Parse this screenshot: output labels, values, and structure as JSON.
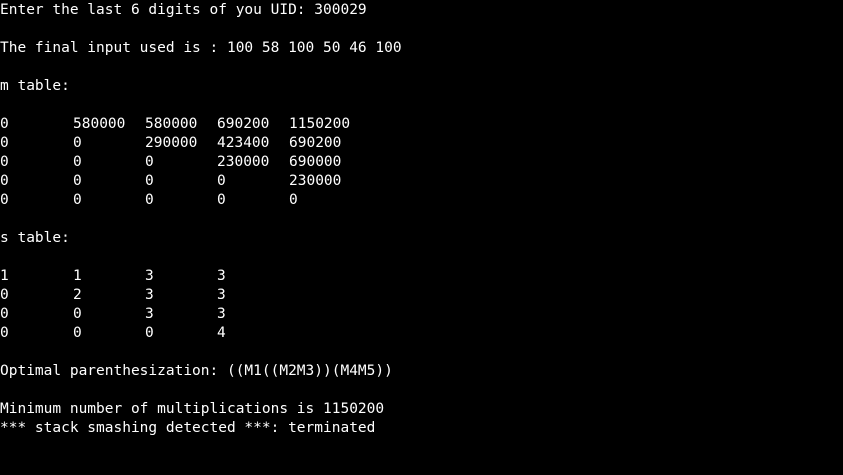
{
  "terminal": {
    "uid_prompt": "Enter the last 6 digits of you UID: 300029",
    "final_input": "The final input used is : 100 58 100 50 46 100",
    "m_table_title": "m table:",
    "m_table": [
      [
        "0",
        "580000",
        "580000",
        "690200",
        "1150200"
      ],
      [
        "0",
        "0",
        "290000",
        "423400",
        "690200"
      ],
      [
        "0",
        "0",
        "0",
        "230000",
        "690000"
      ],
      [
        "0",
        "0",
        "0",
        "0",
        "230000"
      ],
      [
        "0",
        "0",
        "0",
        "0",
        "0"
      ]
    ],
    "s_table_title": "s table:",
    "s_table": [
      [
        "1",
        "1",
        "3",
        "3"
      ],
      [
        "0",
        "2",
        "3",
        "3"
      ],
      [
        "0",
        "0",
        "3",
        "3"
      ],
      [
        "0",
        "0",
        "0",
        "4"
      ]
    ],
    "optimal": "Optimal parenthesization: ((M1((M2M3))(M4M5))",
    "minimum": "Minimum number of multiplications is 1150200",
    "error": "*** stack smashing detected ***: terminated"
  },
  "colors": {
    "background": "#000000",
    "text": "#ffffff"
  }
}
